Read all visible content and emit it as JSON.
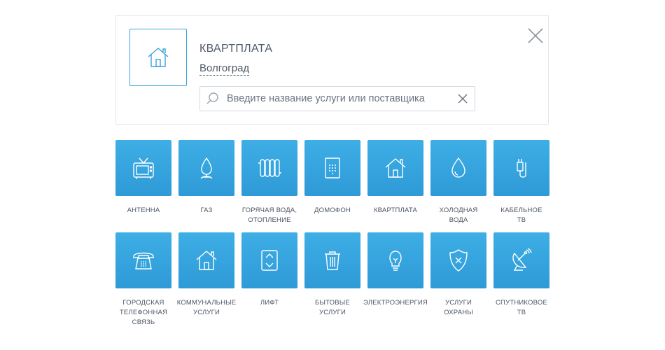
{
  "header": {
    "category_title": "КВАРТПЛАТА",
    "city": "Волгоград",
    "search_placeholder": "Введите название услуги или поставщика"
  },
  "tiles": [
    {
      "label": "АНТЕННА",
      "icon": "tv-antenna-icon"
    },
    {
      "label": "ГАЗ",
      "icon": "gas-flame-icon"
    },
    {
      "label": "ГОРЯЧАЯ ВОДА,\nОТОПЛЕНИЕ",
      "icon": "radiator-icon"
    },
    {
      "label": "ДОМОФОН",
      "icon": "intercom-icon"
    },
    {
      "label": "КВАРТПЛАТА",
      "icon": "house-icon"
    },
    {
      "label": "ХОЛОДНАЯ\nВОДА",
      "icon": "water-drop-icon"
    },
    {
      "label": "КАБЕЛЬНОЕ\nТВ",
      "icon": "cable-plug-icon"
    },
    {
      "label": "ГОРОДСКАЯ\nТЕЛЕФОННАЯ\nСВЯЗЬ",
      "icon": "telephone-icon"
    },
    {
      "label": "КОММУНАЛЬНЫЕ\nУСЛУГИ",
      "icon": "house-icon"
    },
    {
      "label": "ЛИФТ",
      "icon": "elevator-icon"
    },
    {
      "label": "БЫТОВЫЕ\nУСЛУГИ",
      "icon": "trash-bin-icon"
    },
    {
      "label": "ЭЛЕКТРОЭНЕРГИЯ",
      "icon": "light-bulb-icon"
    },
    {
      "label": "УСЛУГИ\nОХРАНЫ",
      "icon": "shield-icon"
    },
    {
      "label": "СПУТНИКОВОЕ\nТВ",
      "icon": "satellite-dish-icon"
    }
  ],
  "colors": {
    "tile_blue": "#3aa6e0",
    "accent_border": "#3aa3d9",
    "text": "#505a68"
  }
}
